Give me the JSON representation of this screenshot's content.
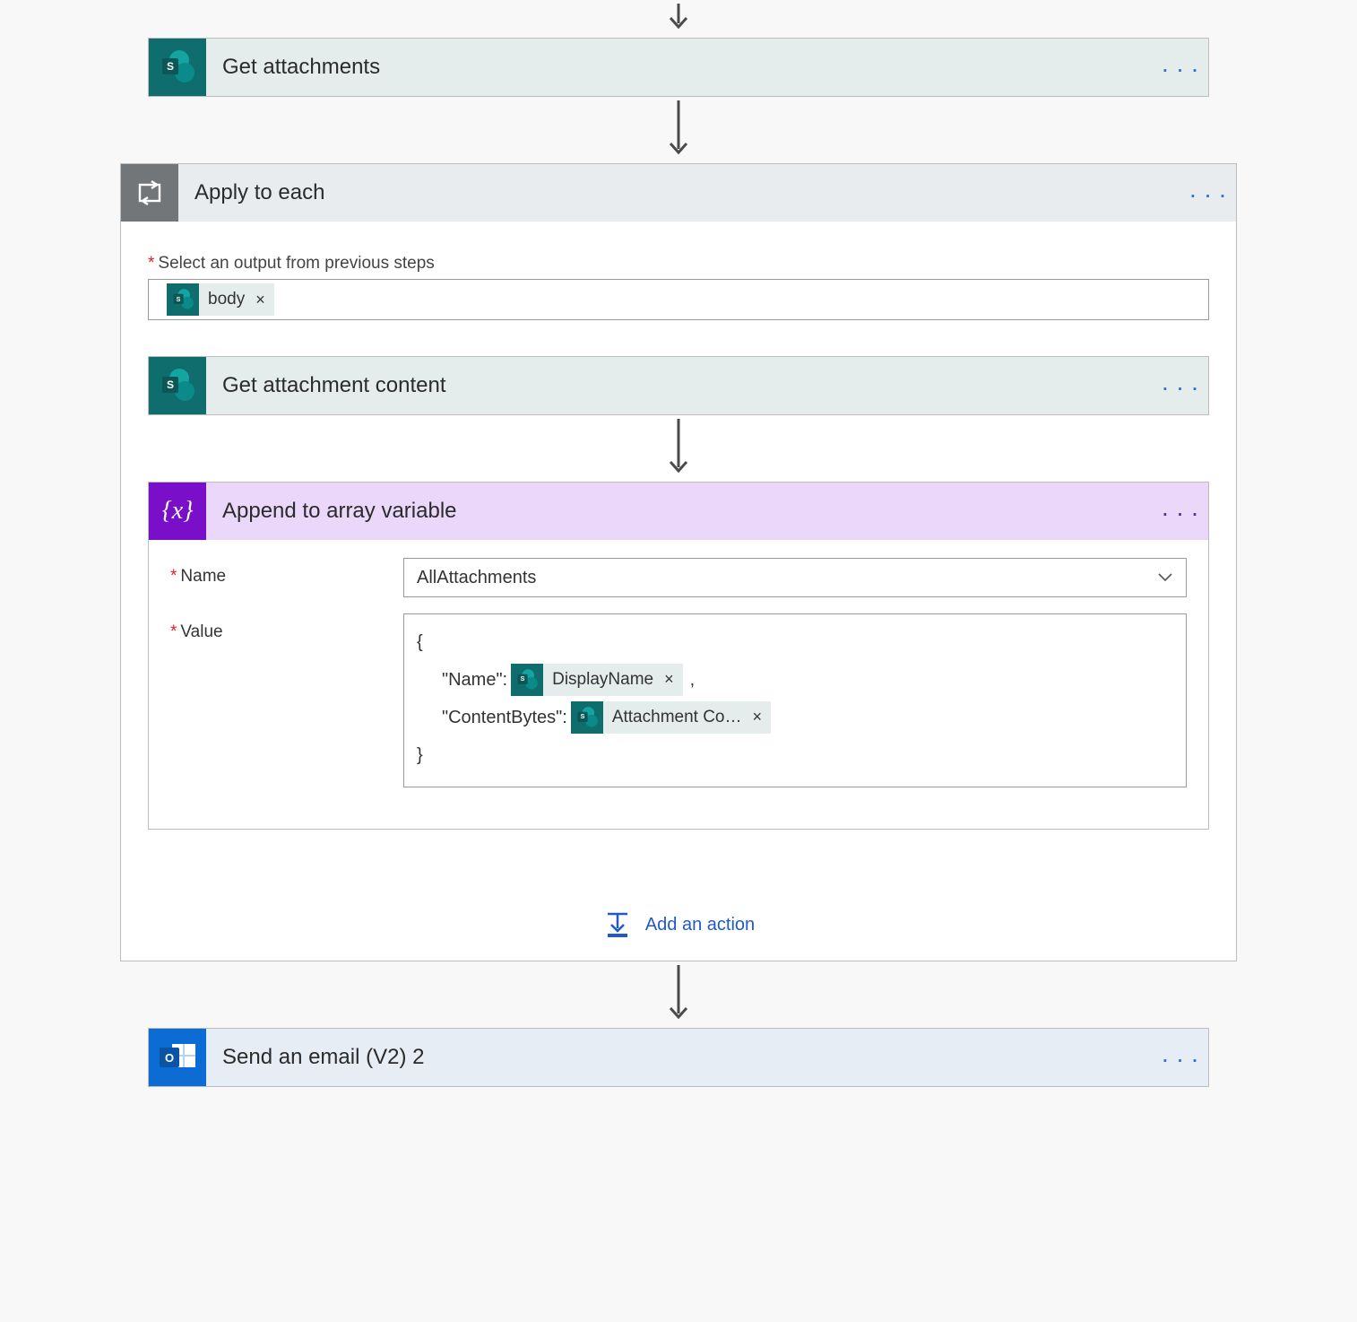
{
  "steps": {
    "get_attachments": {
      "title": "Get attachments"
    },
    "apply_to_each": {
      "title": "Apply to each",
      "input_label": "Select an output from previous steps",
      "token_body": "body",
      "inner": {
        "get_content": {
          "title": "Get attachment content"
        },
        "append": {
          "title": "Append to array variable",
          "name_label": "Name",
          "name_value": "AllAttachments",
          "value_label": "Value",
          "code_open": "{",
          "code_name_key": "\"Name\":",
          "token_displayname": "DisplayName",
          "code_comma": ",",
          "code_content_key": "\"ContentBytes\":",
          "token_attachment_content": "Attachment Co…",
          "code_close": "}"
        }
      },
      "add_action": "Add an action"
    },
    "send_email": {
      "title": "Send an email (V2) 2"
    }
  },
  "glyphs": {
    "ellipsis": ". . .",
    "close": "×"
  }
}
